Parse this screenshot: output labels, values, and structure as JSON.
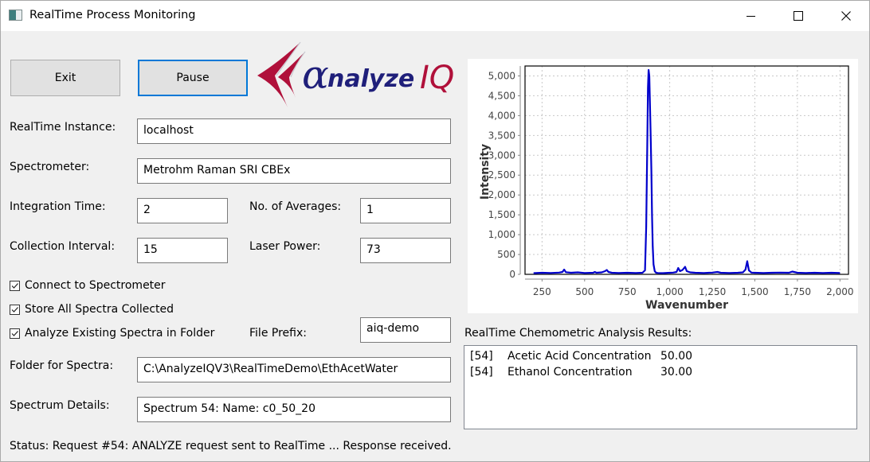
{
  "window": {
    "title": "RealTime Process Monitoring",
    "controls": {
      "minimize": "minimize",
      "maximize": "maximize",
      "close": "close"
    }
  },
  "buttons": {
    "exit_label": "Exit",
    "pause_label": "Pause"
  },
  "logo": {
    "alpha": "α",
    "text": "nalyze",
    "suffix": "IQ",
    "primary_color": "#1f1f7a",
    "accent_color": "#b0103a"
  },
  "form": {
    "realtime_instance": {
      "label": "RealTime Instance:",
      "value": "localhost"
    },
    "spectrometer": {
      "label": "Spectrometer:",
      "value": "Metrohm Raman SRI CBEx"
    },
    "integration_time": {
      "label": "Integration Time:",
      "value": "2"
    },
    "no_of_averages": {
      "label": "No. of Averages:",
      "value": "1"
    },
    "collection_interval": {
      "label": "Collection Interval:",
      "value": "15"
    },
    "laser_power": {
      "label": "Laser Power:",
      "value": "73"
    },
    "file_prefix": {
      "label": "File Prefix:",
      "value": "aiq-demo"
    },
    "folder_for_spectra": {
      "label": "Folder for Spectra:",
      "value": "C:\\AnalyzeIQV3\\RealTimeDemo\\EthAcetWater"
    },
    "spectrum_details": {
      "label": "Spectrum Details:",
      "value": "Spectrum 54: Name: c0_50_20"
    }
  },
  "checkboxes": [
    {
      "label": "Connect to Spectrometer",
      "checked": true
    },
    {
      "label": "Store All Spectra Collected",
      "checked": true
    },
    {
      "label": "Analyze Existing Spectra in Folder",
      "checked": true
    }
  ],
  "status": "Status: Request #54: ANALYZE request sent to RealTime ... Response received.",
  "results": {
    "label": "RealTime Chemometric Analysis Results:",
    "rows": [
      {
        "id": "[54]",
        "name": "Acetic Acid Concentration",
        "value": "50.00"
      },
      {
        "id": "[54]",
        "name": "Ethanol Concentration",
        "value": "30.00"
      }
    ]
  },
  "chart_data": {
    "type": "line",
    "title": "",
    "xlabel": "Wavenumber",
    "ylabel": "Intensity",
    "xlim": [
      150,
      2050
    ],
    "ylim": [
      0,
      5250
    ],
    "x_ticks": [
      250,
      500,
      750,
      1000,
      1250,
      1500,
      1750,
      2000
    ],
    "x_tick_labels": [
      "250",
      "500",
      "750",
      "1,000",
      "1,250",
      "1,500",
      "1,750",
      "2,000"
    ],
    "y_ticks": [
      0,
      500,
      1000,
      1500,
      2000,
      2500,
      3000,
      3500,
      4000,
      4500,
      5000
    ],
    "y_tick_labels": [
      "0",
      "500",
      "1,000",
      "1,500",
      "2,000",
      "2,500",
      "3,000",
      "3,500",
      "4,000",
      "4,500",
      "5,000"
    ],
    "grid": true,
    "legend": "none",
    "series": [
      {
        "name": "Spectrum 54",
        "color": "#0000cc",
        "x": [
          200,
          250,
          300,
          350,
          370,
          380,
          390,
          420,
          460,
          500,
          550,
          560,
          570,
          600,
          620,
          630,
          640,
          660,
          700,
          750,
          800,
          840,
          855,
          862,
          868,
          872,
          876,
          880,
          884,
          888,
          892,
          896,
          900,
          905,
          912,
          920,
          930,
          960,
          1000,
          1020,
          1040,
          1050,
          1060,
          1075,
          1090,
          1100,
          1120,
          1150,
          1200,
          1250,
          1280,
          1300,
          1350,
          1400,
          1430,
          1445,
          1455,
          1465,
          1480,
          1500,
          1550,
          1600,
          1650,
          1700,
          1720,
          1750,
          1800,
          1850,
          1900,
          1950,
          2000
        ],
        "y": [
          30,
          40,
          35,
          45,
          60,
          120,
          55,
          40,
          50,
          35,
          40,
          60,
          40,
          50,
          80,
          110,
          60,
          40,
          35,
          40,
          35,
          40,
          100,
          1200,
          3200,
          4700,
          5150,
          5000,
          4300,
          3500,
          2600,
          1500,
          700,
          250,
          80,
          40,
          35,
          30,
          40,
          45,
          60,
          160,
          80,
          110,
          190,
          80,
          50,
          40,
          35,
          45,
          60,
          40,
          35,
          40,
          50,
          120,
          330,
          100,
          45,
          40,
          35,
          40,
          45,
          40,
          70,
          40,
          35,
          40,
          35,
          40,
          35
        ]
      }
    ]
  }
}
